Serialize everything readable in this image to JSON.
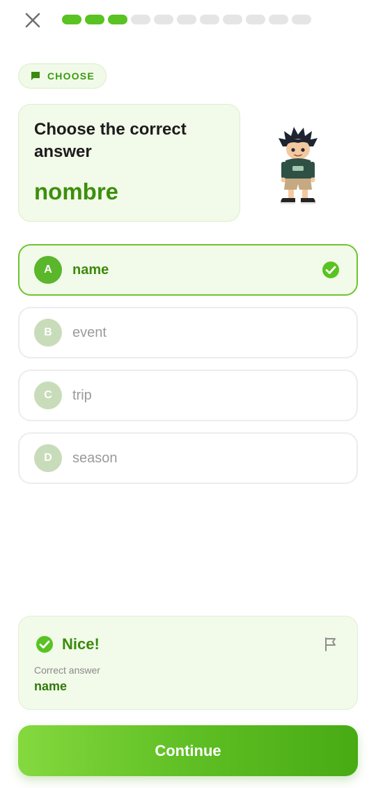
{
  "progress": {
    "total": 11,
    "completed": 3,
    "done_color": "#58c322",
    "todo_color": "#e5e5e5"
  },
  "header": {
    "close_icon": "close-icon"
  },
  "chip": {
    "label": "CHOOSE",
    "icon": "chat-bubble-icon"
  },
  "question": {
    "prompt": "Choose the correct answer",
    "word": "nombre"
  },
  "options": [
    {
      "letter": "A",
      "label": "name",
      "selected": true
    },
    {
      "letter": "B",
      "label": "event",
      "selected": false
    },
    {
      "letter": "C",
      "label": "trip",
      "selected": false
    },
    {
      "letter": "D",
      "label": "season",
      "selected": false
    }
  ],
  "feedback": {
    "title": "Nice!",
    "subtitle": "Correct answer",
    "answer": "name",
    "icon": "check-circle-icon",
    "report_icon": "flag-icon"
  },
  "continue_button": {
    "label": "Continue"
  },
  "colors": {
    "accent": "#58c322",
    "correct_text": "#3a8a0d"
  }
}
